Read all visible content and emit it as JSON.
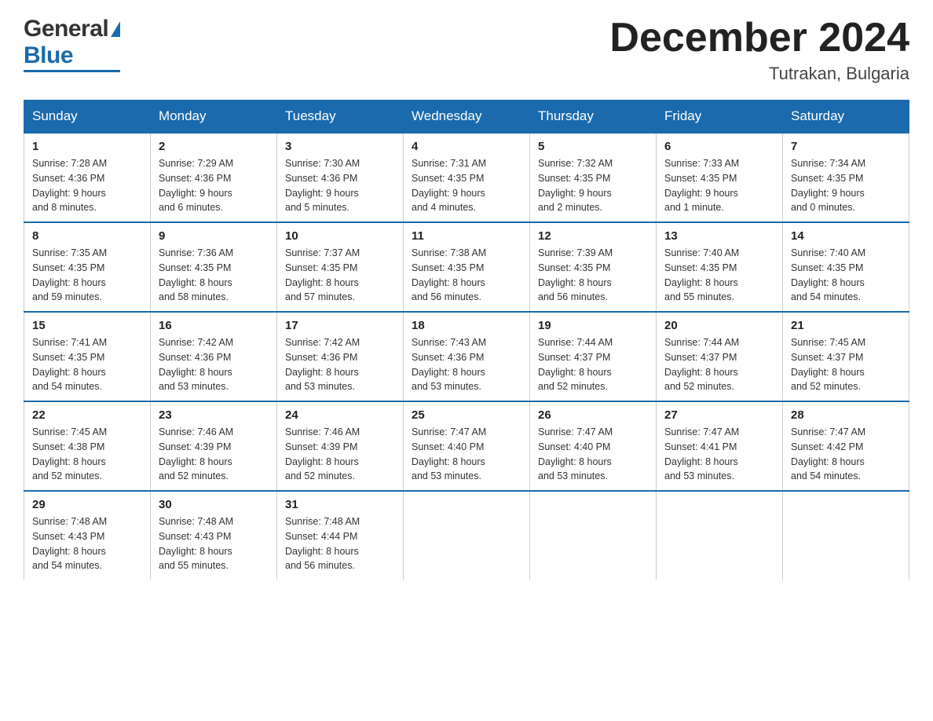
{
  "logo": {
    "general": "General",
    "blue": "Blue",
    "arrow": "▲"
  },
  "header": {
    "month": "December 2024",
    "location": "Tutrakan, Bulgaria"
  },
  "days_header": [
    "Sunday",
    "Monday",
    "Tuesday",
    "Wednesday",
    "Thursday",
    "Friday",
    "Saturday"
  ],
  "weeks": [
    [
      {
        "day": "1",
        "sunrise": "7:28 AM",
        "sunset": "4:36 PM",
        "daylight": "9 hours and 8 minutes."
      },
      {
        "day": "2",
        "sunrise": "7:29 AM",
        "sunset": "4:36 PM",
        "daylight": "9 hours and 6 minutes."
      },
      {
        "day": "3",
        "sunrise": "7:30 AM",
        "sunset": "4:36 PM",
        "daylight": "9 hours and 5 minutes."
      },
      {
        "day": "4",
        "sunrise": "7:31 AM",
        "sunset": "4:35 PM",
        "daylight": "9 hours and 4 minutes."
      },
      {
        "day": "5",
        "sunrise": "7:32 AM",
        "sunset": "4:35 PM",
        "daylight": "9 hours and 2 minutes."
      },
      {
        "day": "6",
        "sunrise": "7:33 AM",
        "sunset": "4:35 PM",
        "daylight": "9 hours and 1 minute."
      },
      {
        "day": "7",
        "sunrise": "7:34 AM",
        "sunset": "4:35 PM",
        "daylight": "9 hours and 0 minutes."
      }
    ],
    [
      {
        "day": "8",
        "sunrise": "7:35 AM",
        "sunset": "4:35 PM",
        "daylight": "8 hours and 59 minutes."
      },
      {
        "day": "9",
        "sunrise": "7:36 AM",
        "sunset": "4:35 PM",
        "daylight": "8 hours and 58 minutes."
      },
      {
        "day": "10",
        "sunrise": "7:37 AM",
        "sunset": "4:35 PM",
        "daylight": "8 hours and 57 minutes."
      },
      {
        "day": "11",
        "sunrise": "7:38 AM",
        "sunset": "4:35 PM",
        "daylight": "8 hours and 56 minutes."
      },
      {
        "day": "12",
        "sunrise": "7:39 AM",
        "sunset": "4:35 PM",
        "daylight": "8 hours and 56 minutes."
      },
      {
        "day": "13",
        "sunrise": "7:40 AM",
        "sunset": "4:35 PM",
        "daylight": "8 hours and 55 minutes."
      },
      {
        "day": "14",
        "sunrise": "7:40 AM",
        "sunset": "4:35 PM",
        "daylight": "8 hours and 54 minutes."
      }
    ],
    [
      {
        "day": "15",
        "sunrise": "7:41 AM",
        "sunset": "4:35 PM",
        "daylight": "8 hours and 54 minutes."
      },
      {
        "day": "16",
        "sunrise": "7:42 AM",
        "sunset": "4:36 PM",
        "daylight": "8 hours and 53 minutes."
      },
      {
        "day": "17",
        "sunrise": "7:42 AM",
        "sunset": "4:36 PM",
        "daylight": "8 hours and 53 minutes."
      },
      {
        "day": "18",
        "sunrise": "7:43 AM",
        "sunset": "4:36 PM",
        "daylight": "8 hours and 53 minutes."
      },
      {
        "day": "19",
        "sunrise": "7:44 AM",
        "sunset": "4:37 PM",
        "daylight": "8 hours and 52 minutes."
      },
      {
        "day": "20",
        "sunrise": "7:44 AM",
        "sunset": "4:37 PM",
        "daylight": "8 hours and 52 minutes."
      },
      {
        "day": "21",
        "sunrise": "7:45 AM",
        "sunset": "4:37 PM",
        "daylight": "8 hours and 52 minutes."
      }
    ],
    [
      {
        "day": "22",
        "sunrise": "7:45 AM",
        "sunset": "4:38 PM",
        "daylight": "8 hours and 52 minutes."
      },
      {
        "day": "23",
        "sunrise": "7:46 AM",
        "sunset": "4:39 PM",
        "daylight": "8 hours and 52 minutes."
      },
      {
        "day": "24",
        "sunrise": "7:46 AM",
        "sunset": "4:39 PM",
        "daylight": "8 hours and 52 minutes."
      },
      {
        "day": "25",
        "sunrise": "7:47 AM",
        "sunset": "4:40 PM",
        "daylight": "8 hours and 53 minutes."
      },
      {
        "day": "26",
        "sunrise": "7:47 AM",
        "sunset": "4:40 PM",
        "daylight": "8 hours and 53 minutes."
      },
      {
        "day": "27",
        "sunrise": "7:47 AM",
        "sunset": "4:41 PM",
        "daylight": "8 hours and 53 minutes."
      },
      {
        "day": "28",
        "sunrise": "7:47 AM",
        "sunset": "4:42 PM",
        "daylight": "8 hours and 54 minutes."
      }
    ],
    [
      {
        "day": "29",
        "sunrise": "7:48 AM",
        "sunset": "4:43 PM",
        "daylight": "8 hours and 54 minutes."
      },
      {
        "day": "30",
        "sunrise": "7:48 AM",
        "sunset": "4:43 PM",
        "daylight": "8 hours and 55 minutes."
      },
      {
        "day": "31",
        "sunrise": "7:48 AM",
        "sunset": "4:44 PM",
        "daylight": "8 hours and 56 minutes."
      },
      null,
      null,
      null,
      null
    ]
  ]
}
